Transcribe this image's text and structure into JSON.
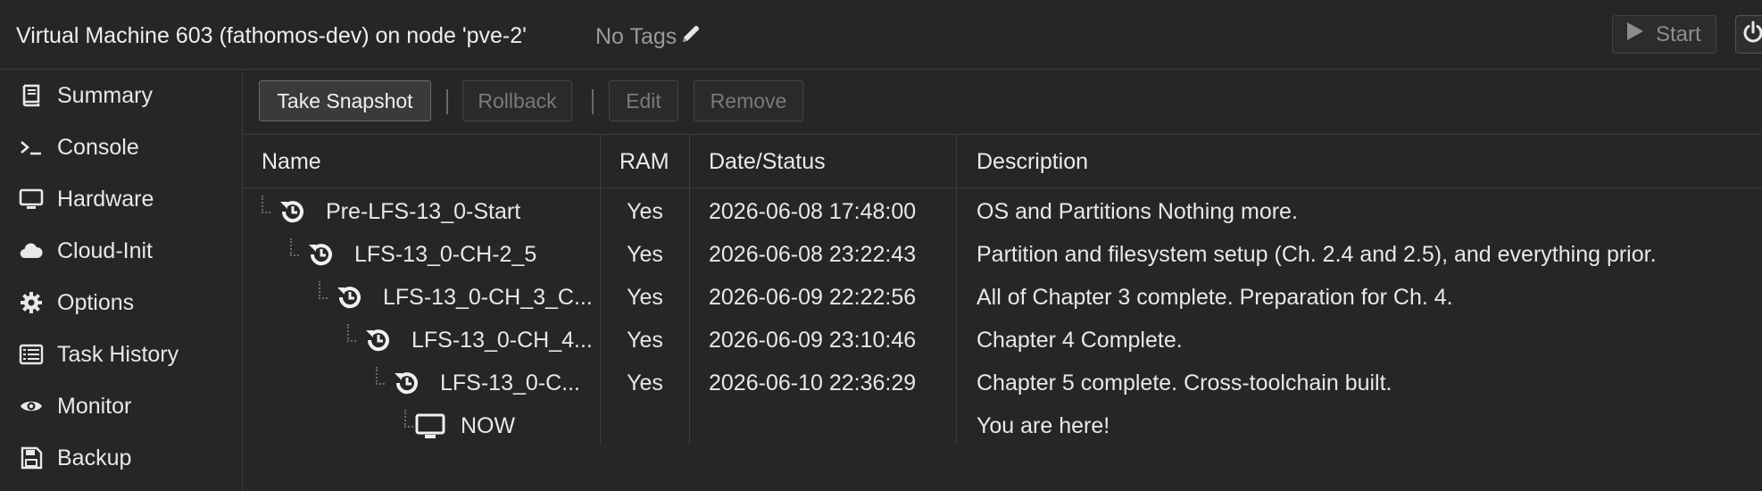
{
  "header": {
    "title": "Virtual Machine 603 (fathomos-dev) on node 'pve-2'",
    "tags_label": "No Tags",
    "start_label": "Start"
  },
  "sidebar": {
    "items": [
      {
        "label": "Summary",
        "icon": "book-icon"
      },
      {
        "label": "Console",
        "icon": "terminal-icon"
      },
      {
        "label": "Hardware",
        "icon": "monitor-icon"
      },
      {
        "label": "Cloud-Init",
        "icon": "cloud-icon"
      },
      {
        "label": "Options",
        "icon": "gear-icon"
      },
      {
        "label": "Task History",
        "icon": "list-icon"
      },
      {
        "label": "Monitor",
        "icon": "eye-icon"
      },
      {
        "label": "Backup",
        "icon": "floppy-icon"
      }
    ]
  },
  "toolbar": {
    "take_snapshot": "Take Snapshot",
    "rollback": "Rollback",
    "edit": "Edit",
    "remove": "Remove"
  },
  "grid": {
    "columns": [
      "Name",
      "RAM",
      "Date/Status",
      "Description"
    ],
    "rows": [
      {
        "name": "Pre-LFS-13_0-Start",
        "ram": "Yes",
        "date": "2026-06-08 17:48:00",
        "description": "OS and Partitions Nothing more.",
        "icon": "snapshot-icon"
      },
      {
        "name": "LFS-13_0-CH-2_5",
        "ram": "Yes",
        "date": "2026-06-08 23:22:43",
        "description": "Partition and filesystem setup (Ch. 2.4 and 2.5), and everything prior.",
        "icon": "snapshot-icon"
      },
      {
        "name": "LFS-13_0-CH_3_C...",
        "ram": "Yes",
        "date": "2026-06-09 22:22:56",
        "description": "All of Chapter 3 complete. Preparation for Ch. 4.",
        "icon": "snapshot-icon"
      },
      {
        "name": "LFS-13_0-CH_4...",
        "ram": "Yes",
        "date": "2026-06-09 23:10:46",
        "description": "Chapter 4 Complete.",
        "icon": "snapshot-icon"
      },
      {
        "name": "LFS-13_0-C...",
        "ram": "Yes",
        "date": "2026-06-10 22:36:29",
        "description": "Chapter 5 complete. Cross-toolchain built.",
        "icon": "snapshot-icon"
      },
      {
        "name": "NOW",
        "ram": "",
        "date": "",
        "description": "You are here!",
        "icon": "monitor-icon"
      }
    ]
  },
  "colors": {
    "background": "#262626",
    "border": "#3c3c3c",
    "text": "#e8e8e8",
    "disabled_text": "#7a7a7a"
  }
}
